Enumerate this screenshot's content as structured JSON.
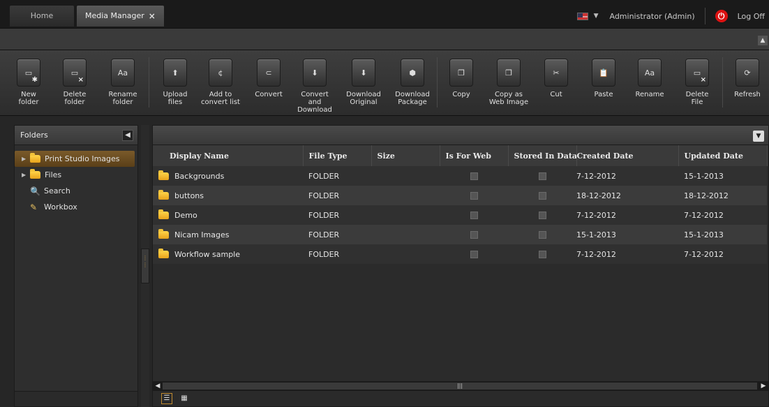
{
  "tabs": {
    "home": "Home",
    "active": "Media Manager",
    "close": "×"
  },
  "user": {
    "name": "Administrator (Admin)",
    "logoff": "Log Off"
  },
  "toolbar": {
    "items": [
      {
        "label": "New\nfolder",
        "icon": "new-folder-icon"
      },
      {
        "label": "Delete\nfolder",
        "icon": "delete-folder-icon"
      },
      {
        "label": "Rename\nfolder",
        "icon": "rename-folder-icon"
      },
      {
        "label": "Upload\nfiles",
        "icon": "upload-icon"
      },
      {
        "label": "Add to\nconvert list",
        "icon": "add-convert-icon"
      },
      {
        "label": "Convert",
        "icon": "convert-icon"
      },
      {
        "label": "Convert\nand Download",
        "icon": "convert-download-icon"
      },
      {
        "label": "Download\nOriginal",
        "icon": "download-original-icon"
      },
      {
        "label": "Download\nPackage",
        "icon": "download-package-icon"
      },
      {
        "label": "Copy",
        "icon": "copy-icon"
      },
      {
        "label": "Copy as\nWeb Image",
        "icon": "copy-web-icon"
      },
      {
        "label": "Cut",
        "icon": "cut-icon"
      },
      {
        "label": "Paste",
        "icon": "paste-icon"
      },
      {
        "label": "Rename",
        "icon": "rename-icon"
      },
      {
        "label": "Delete\nFile",
        "icon": "delete-file-icon"
      },
      {
        "label": "Refresh",
        "icon": "refresh-icon"
      }
    ]
  },
  "folders": {
    "title": "Folders",
    "nodes": [
      {
        "label": "Print Studio Images"
      },
      {
        "label": "Files"
      },
      {
        "label": "Search"
      },
      {
        "label": "Workbox"
      }
    ]
  },
  "grid": {
    "columns": [
      "Display Name",
      "File Type",
      "Size",
      "Is For Web",
      "Stored In Database",
      "Created Date",
      "Updated Date"
    ],
    "rows": [
      {
        "name": "Backgrounds",
        "type": "FOLDER",
        "size": "",
        "created": "7-12-2012",
        "updated": "15-1-2013"
      },
      {
        "name": "buttons",
        "type": "FOLDER",
        "size": "",
        "created": "18-12-2012",
        "updated": "18-12-2012"
      },
      {
        "name": "Demo",
        "type": "FOLDER",
        "size": "",
        "created": "7-12-2012",
        "updated": "7-12-2012"
      },
      {
        "name": "Nicam Images",
        "type": "FOLDER",
        "size": "",
        "created": "15-1-2013",
        "updated": "15-1-2013"
      },
      {
        "name": "Workflow sample",
        "type": "FOLDER",
        "size": "",
        "created": "7-12-2012",
        "updated": "7-12-2012"
      }
    ]
  }
}
